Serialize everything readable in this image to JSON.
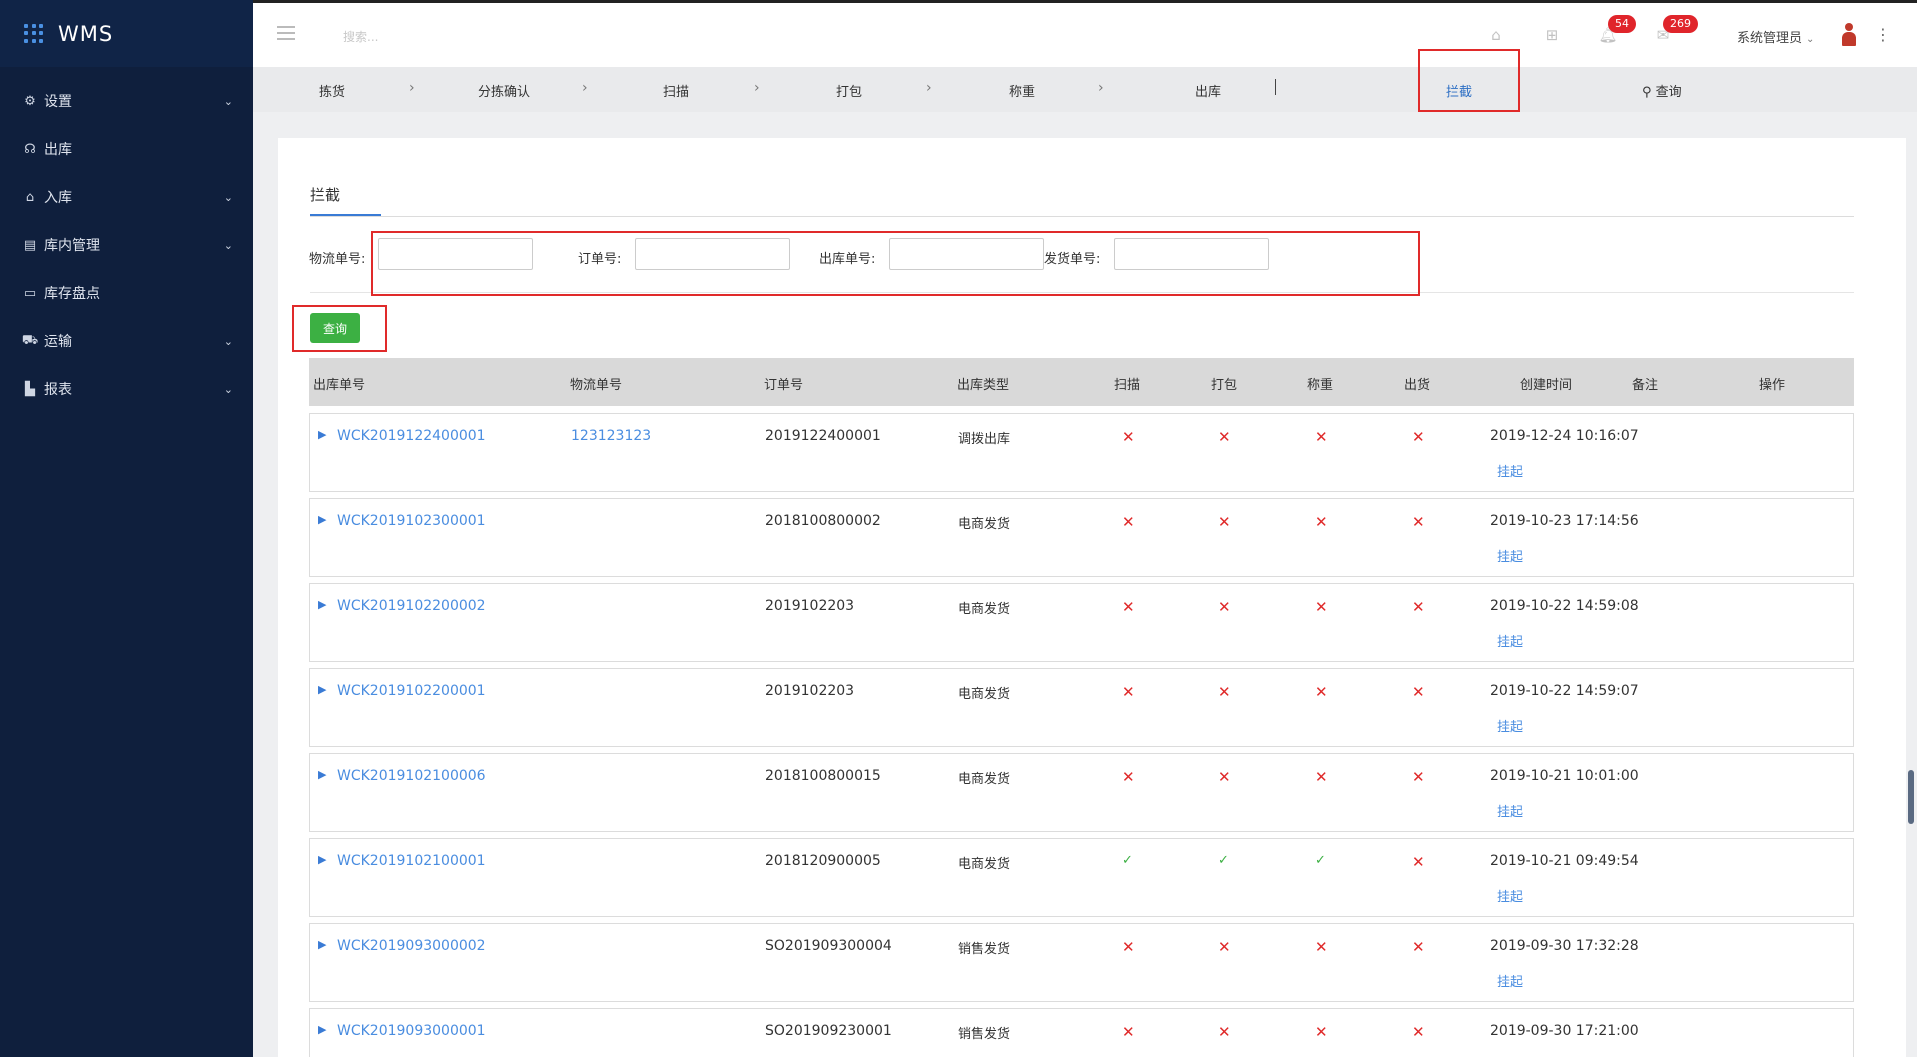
{
  "app": {
    "brand": "WMS"
  },
  "sidebar": {
    "items": [
      {
        "label": "设置",
        "icon": "gear-icon",
        "has_children": true
      },
      {
        "label": "出库",
        "icon": "headset-icon",
        "has_children": false
      },
      {
        "label": "入库",
        "icon": "home-upload-icon",
        "has_children": true
      },
      {
        "label": "库内管理",
        "icon": "box-icon",
        "has_children": true
      },
      {
        "label": "库存盘点",
        "icon": "clipboard-icon",
        "has_children": false
      },
      {
        "label": "运输",
        "icon": "truck-icon",
        "has_children": true
      },
      {
        "label": "报表",
        "icon": "bar-chart-icon",
        "has_children": true
      }
    ]
  },
  "header": {
    "search_placeholder": "搜索...",
    "notifications_count": "54",
    "messages_count": "269",
    "user_name": "系统管理员"
  },
  "flow": {
    "steps": [
      "拣货",
      "分拣确认",
      "扫描",
      "打包",
      "称重",
      "出库"
    ],
    "active": "拦截",
    "search_label": "查询"
  },
  "content": {
    "section_title": "拦截",
    "filters": [
      {
        "label": "物流单号:",
        "value": ""
      },
      {
        "label": "订单号:",
        "value": ""
      },
      {
        "label": "出库单号:",
        "value": ""
      },
      {
        "label": "发货单号:",
        "value": ""
      }
    ],
    "query_button": "查询",
    "columns": [
      "出库单号",
      "物流单号",
      "订单号",
      "出库类型",
      "扫描",
      "打包",
      "称重",
      "出货",
      "创建时间",
      "备注",
      "操作"
    ],
    "rows": [
      {
        "outbound_no": "WCK2019122400001",
        "logistics_no": "123123123",
        "order_no": "2019122400001",
        "type": "调拨出库",
        "scan": "no",
        "pack": "no",
        "weigh": "no",
        "ship": "no",
        "created": "2019-12-24 10:16:07",
        "action": "挂起"
      },
      {
        "outbound_no": "WCK2019102300001",
        "logistics_no": "",
        "order_no": "2018100800002",
        "type": "电商发货",
        "scan": "no",
        "pack": "no",
        "weigh": "no",
        "ship": "no",
        "created": "2019-10-23 17:14:56",
        "action": "挂起"
      },
      {
        "outbound_no": "WCK2019102200002",
        "logistics_no": "",
        "order_no": "2019102203",
        "type": "电商发货",
        "scan": "no",
        "pack": "no",
        "weigh": "no",
        "ship": "no",
        "created": "2019-10-22 14:59:08",
        "action": "挂起"
      },
      {
        "outbound_no": "WCK2019102200001",
        "logistics_no": "",
        "order_no": "2019102203",
        "type": "电商发货",
        "scan": "no",
        "pack": "no",
        "weigh": "no",
        "ship": "no",
        "created": "2019-10-22 14:59:07",
        "action": "挂起"
      },
      {
        "outbound_no": "WCK2019102100006",
        "logistics_no": "",
        "order_no": "2018100800015",
        "type": "电商发货",
        "scan": "no",
        "pack": "no",
        "weigh": "no",
        "ship": "no",
        "created": "2019-10-21 10:01:00",
        "action": "挂起"
      },
      {
        "outbound_no": "WCK2019102100001",
        "logistics_no": "",
        "order_no": "2018120900005",
        "type": "电商发货",
        "scan": "yes",
        "pack": "yes",
        "weigh": "yes",
        "ship": "no",
        "created": "2019-10-21 09:49:54",
        "action": "挂起"
      },
      {
        "outbound_no": "WCK2019093000002",
        "logistics_no": "",
        "order_no": "SO201909300004",
        "type": "销售发货",
        "scan": "no",
        "pack": "no",
        "weigh": "no",
        "ship": "no",
        "created": "2019-09-30 17:32:28",
        "action": "挂起"
      },
      {
        "outbound_no": "WCK2019093000001",
        "logistics_no": "",
        "order_no": "SO201909230001",
        "type": "销售发货",
        "scan": "no",
        "pack": "no",
        "weigh": "no",
        "ship": "no",
        "created": "2019-09-30 17:21:00",
        "action": ""
      }
    ]
  },
  "colors": {
    "sidebar_bg": "#0f1f3d",
    "link": "#4a8de0",
    "fail": "#e02a2a",
    "ok": "#3cb043",
    "highlight": "#e02a2a"
  }
}
